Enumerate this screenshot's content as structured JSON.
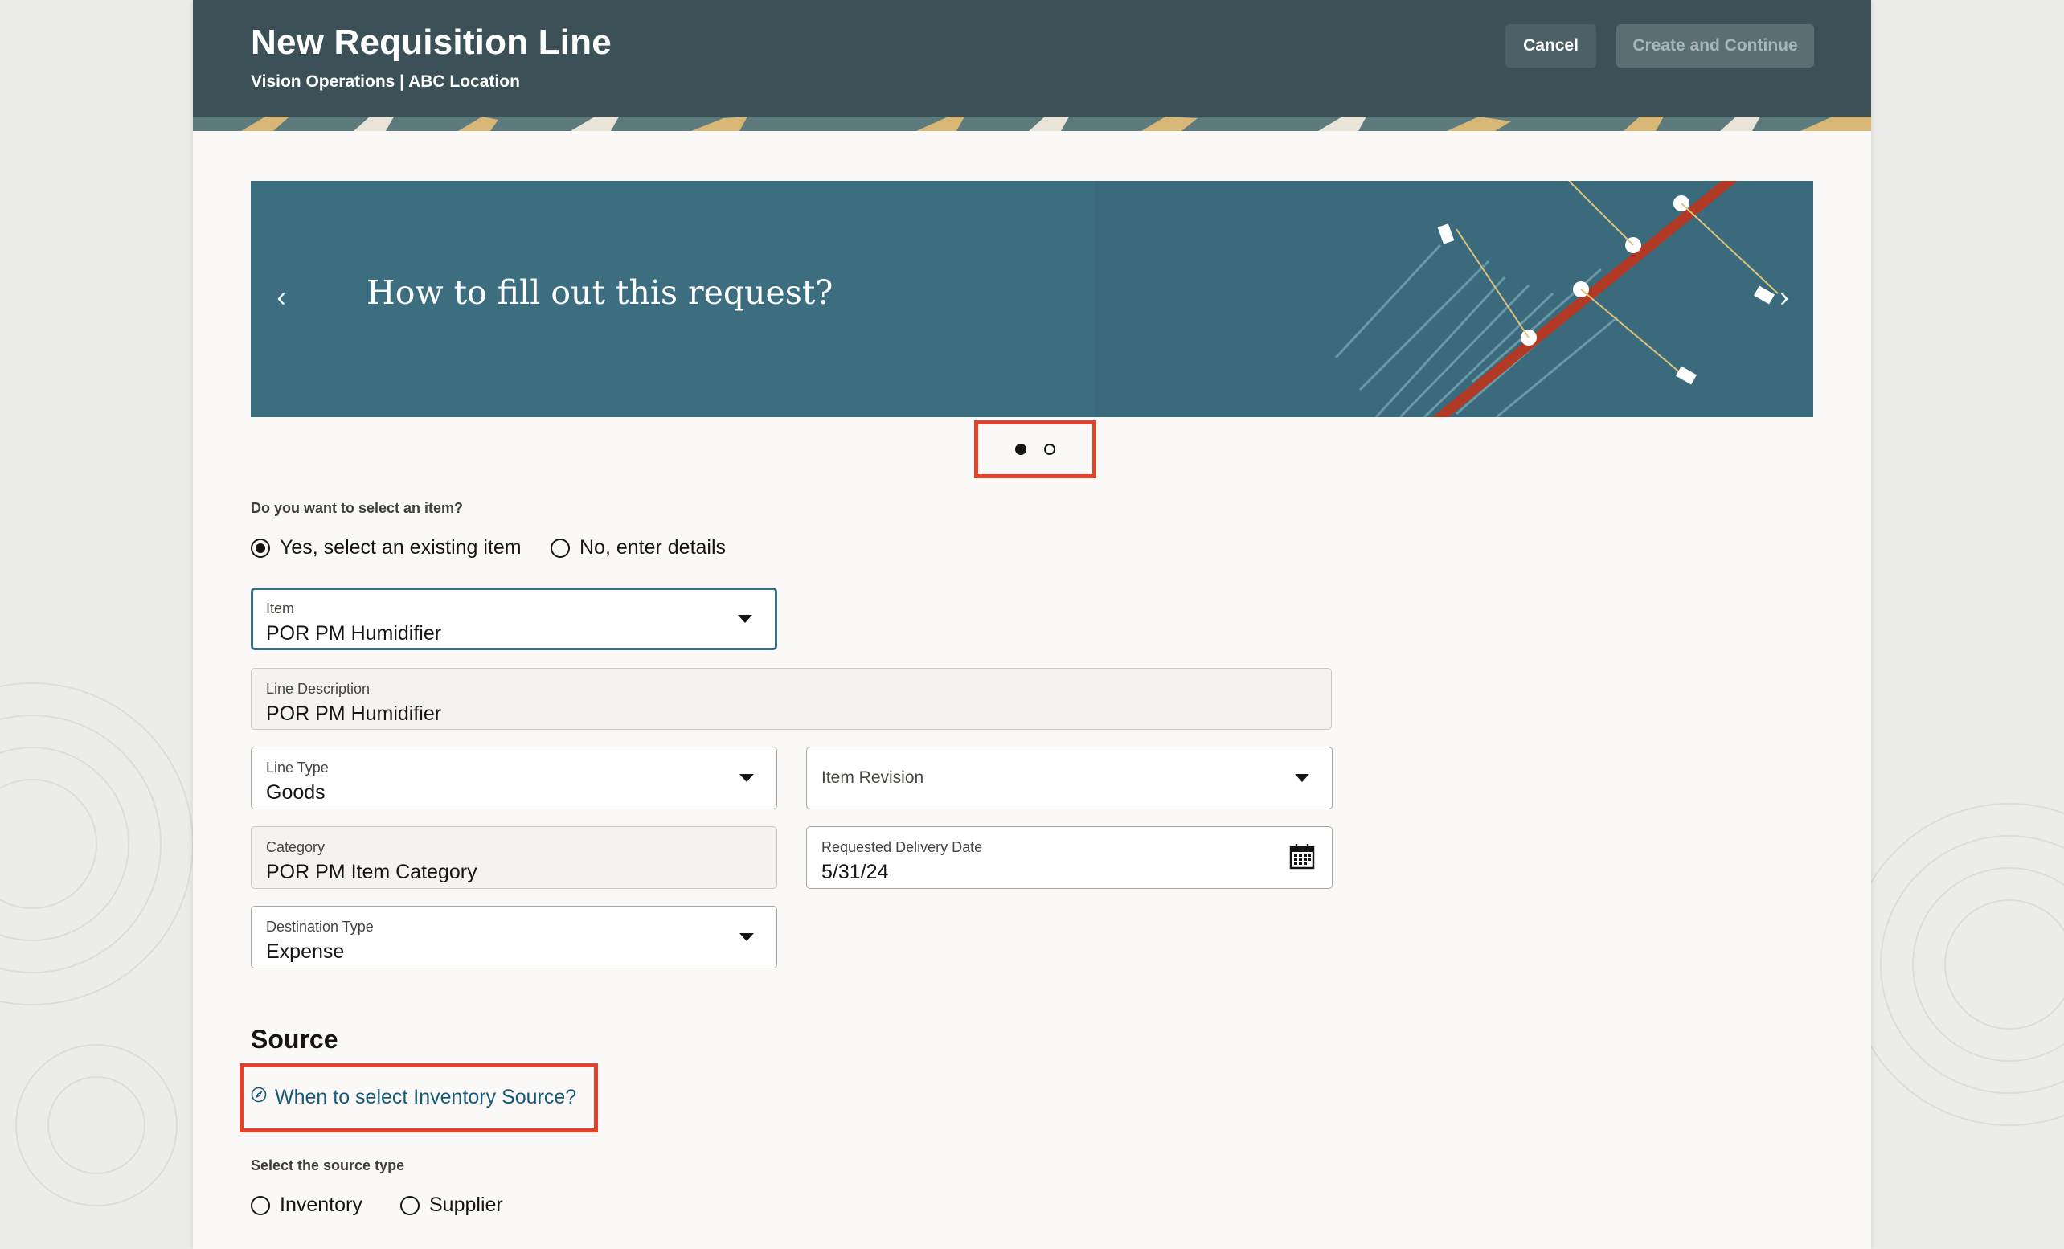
{
  "header": {
    "title": "New Requisition Line",
    "subtitle": "Vision Operations | ABC Location",
    "cancel_label": "Cancel",
    "create_label": "Create and Continue"
  },
  "banner": {
    "title": "How to fill out this request?",
    "prev_icon": "chevron-left-icon",
    "next_icon": "chevron-right-icon",
    "slide_count": 2,
    "active_slide": 1
  },
  "item_question": {
    "label": "Do you want to select an item?",
    "options": [
      {
        "label": "Yes, select an existing item",
        "checked": true
      },
      {
        "label": "No, enter details",
        "checked": false
      }
    ]
  },
  "form": {
    "item": {
      "label": "Item",
      "value": "POR PM Humidifier"
    },
    "line_description": {
      "label": "Line Description",
      "value": "POR PM Humidifier"
    },
    "line_type": {
      "label": "Line Type",
      "value": "Goods"
    },
    "item_revision": {
      "label": "Item Revision"
    },
    "category": {
      "label": "Category",
      "value": "POR PM Item Category"
    },
    "requested_delivery_date": {
      "label": "Requested Delivery Date",
      "value": "5/31/24"
    },
    "destination_type": {
      "label": "Destination Type",
      "value": "Expense"
    }
  },
  "source": {
    "title": "Source",
    "help_link": "When to select Inventory Source?",
    "type_label": "Select the source type",
    "options": [
      {
        "label": "Inventory",
        "checked": false
      },
      {
        "label": "Supplier",
        "checked": false
      }
    ]
  },
  "colors": {
    "header_bg": "#3b5157",
    "banner_bg": "#3d6e80",
    "highlight": "#e0422b",
    "link": "#155a78"
  }
}
